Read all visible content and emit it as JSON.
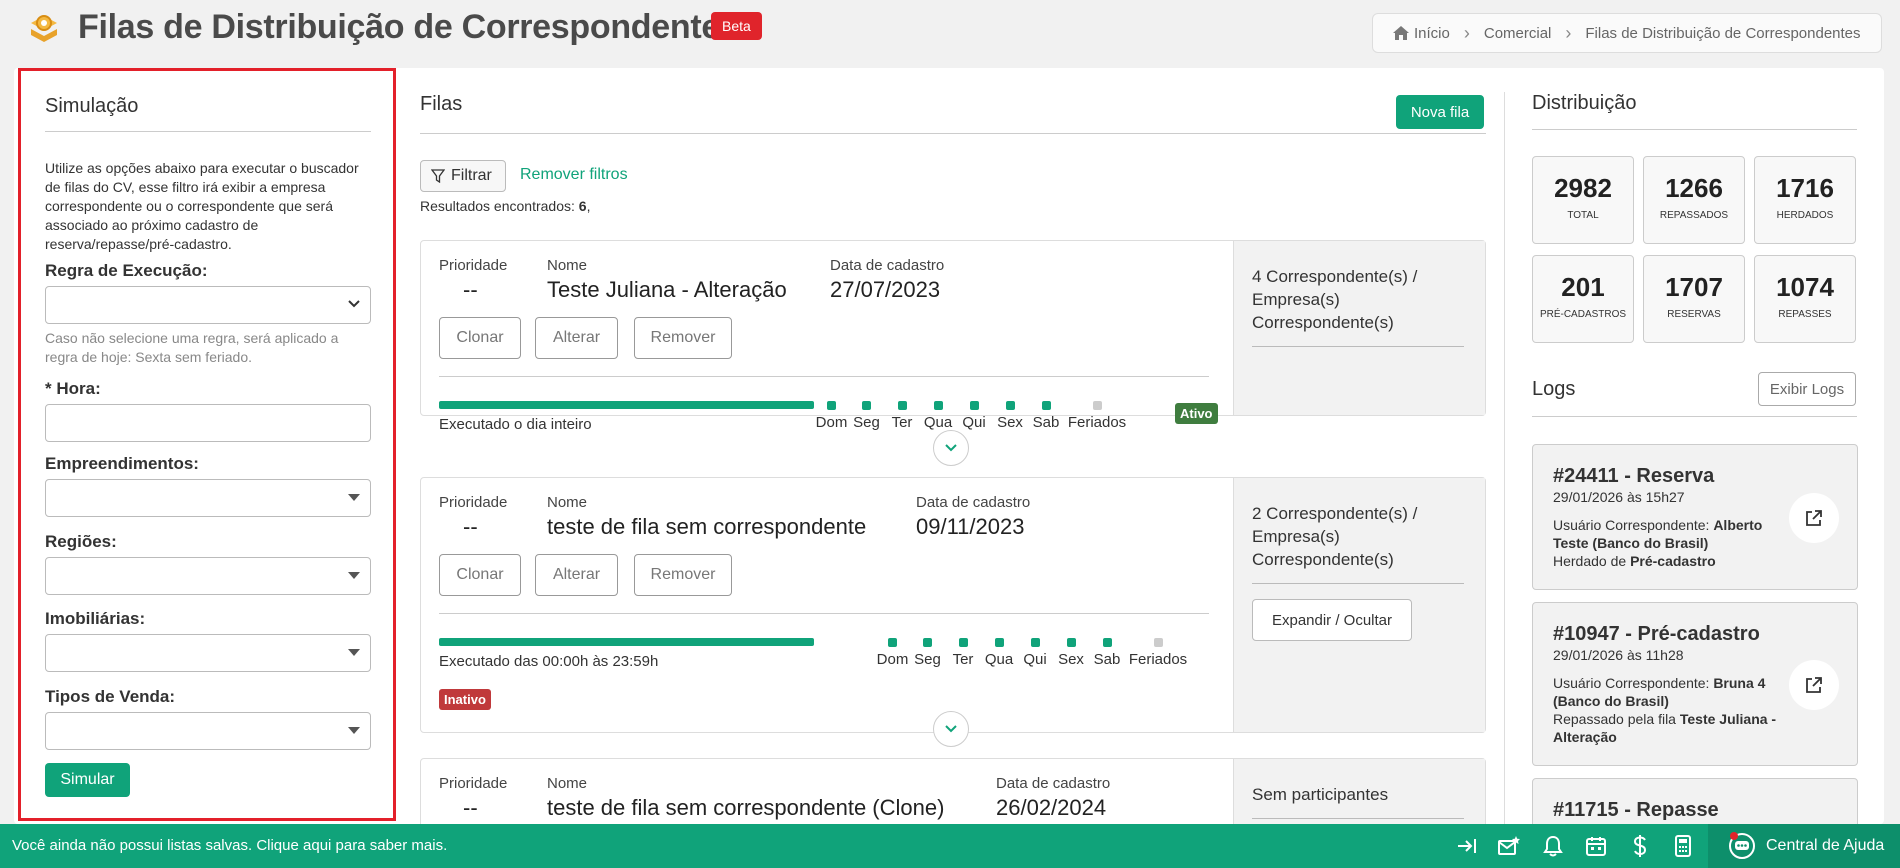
{
  "header": {
    "title": "Filas de Distribuição de Correspondentes",
    "beta_label": "Beta",
    "breadcrumb": [
      "Início",
      "Comercial",
      "Filas de Distribuição de Correspondentes"
    ]
  },
  "simulacao": {
    "title": "Simulação",
    "description": "Utilize as opções abaixo para executar o buscador de filas do CV, esse filtro irá exibir a empresa correspondente ou o correspondente que será associado ao próximo cadastro de reserva/repasse/pré-cadastro.",
    "regra_label": "Regra de Execução:",
    "regra_help": "Caso não selecione uma regra, será aplicado a regra de hoje: Sexta sem feriado.",
    "hora_label": "* Hora:",
    "empreendimentos_label": "Empreendimentos:",
    "regioes_label": "Regiões:",
    "imobiliarias_label": "Imobiliárias:",
    "tipos_venda_label": "Tipos de Venda:",
    "simular_label": "Simular"
  },
  "filas": {
    "title": "Filas",
    "nova_fila_label": "Nova fila",
    "filtrar_label": "Filtrar",
    "remover_filtros_label": "Remover filtros",
    "resultados_prefix": "Resultados encontrados: ",
    "resultados_count": "6",
    "resultados_suffix": ",",
    "labels": {
      "prioridade": "Prioridade",
      "nome": "Nome",
      "data": "Data de cadastro",
      "clonar": "Clonar",
      "alterar": "Alterar",
      "remover": "Remover",
      "expandir": "Expandir / Ocultar"
    },
    "days": [
      "Dom",
      "Seg",
      "Ter",
      "Qua",
      "Qui",
      "Sex",
      "Sab",
      "Feriados"
    ],
    "items": [
      {
        "prioridade": "--",
        "nome": "Teste Juliana - Alteração",
        "data": "27/07/2023",
        "executado": "Executado o dia inteiro",
        "status": "Ativo",
        "participantes": "4 Correspondente(s) / Empresa(s) Correspondente(s)"
      },
      {
        "prioridade": "--",
        "nome": "teste de fila sem correspondente",
        "data": "09/11/2023",
        "executado": "Executado das 00:00h às 23:59h",
        "status": "Inativo",
        "participantes": "2 Correspondente(s) / Empresa(s) Correspondente(s)"
      },
      {
        "prioridade": "--",
        "nome": "teste de fila sem correspondente (Clone)",
        "data": "26/02/2024",
        "participantes": "Sem participantes"
      }
    ]
  },
  "distribuicao": {
    "title": "Distribuição",
    "stats": [
      {
        "value": "2982",
        "label": "TOTAL"
      },
      {
        "value": "1266",
        "label": "REPASSADOS"
      },
      {
        "value": "1716",
        "label": "HERDADOS"
      },
      {
        "value": "201",
        "label": "PRÉ-CADASTROS"
      },
      {
        "value": "1707",
        "label": "RESERVAS"
      },
      {
        "value": "1074",
        "label": "REPASSES"
      }
    ]
  },
  "logs": {
    "title": "Logs",
    "exibir_label": "Exibir Logs",
    "items": [
      {
        "title": "#24411 - Reserva",
        "date": "29/01/2026 às 15h27",
        "user_prefix": "Usuário Correspondente: ",
        "user": "Alberto Teste (Banco do Brasil)",
        "extra_prefix": "Herdado de ",
        "extra": "Pré-cadastro"
      },
      {
        "title": "#10947 - Pré-cadastro",
        "date": "29/01/2026 às 11h28",
        "user_prefix": "Usuário Correspondente: ",
        "user": "Bruna 4 (Banco do Brasil)",
        "extra_prefix": "Repassado pela fila ",
        "extra": "Teste Juliana - Alteração"
      },
      {
        "title": "#11715 - Repasse"
      }
    ]
  },
  "bottombar": {
    "message": "Você ainda não possui listas salvas. Clique aqui para saber mais.",
    "help_label": "Central de Ajuda",
    "icons": [
      "collapse-right-icon",
      "mail-star-icon",
      "bell-icon",
      "calendar-icon",
      "dollar-icon",
      "calculator-icon",
      "chat-support-icon"
    ]
  },
  "colors": {
    "accent": "#10a37a",
    "beta": "#e0242b",
    "highlight_border": "#e3202a",
    "ativo": "#3f7d3f",
    "inativo": "#c0393b"
  }
}
